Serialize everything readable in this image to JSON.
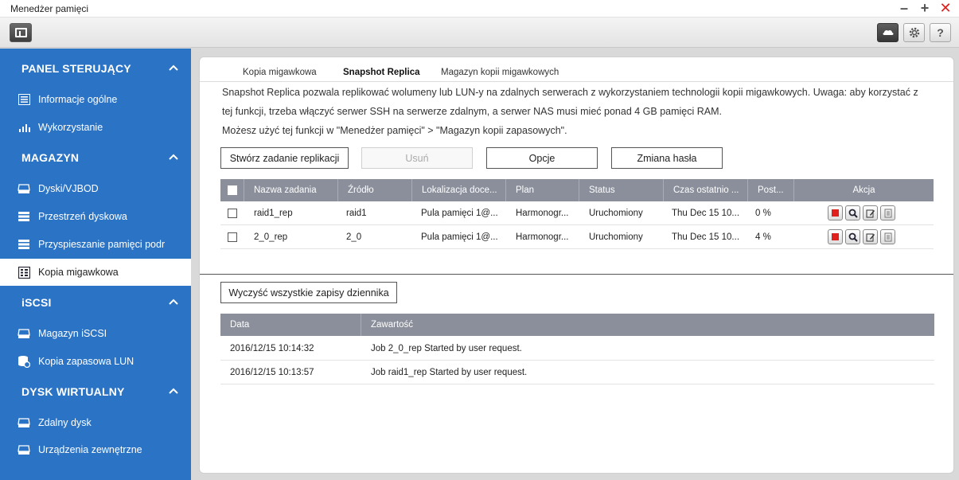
{
  "window": {
    "title": "Menedżer pamięci"
  },
  "sidebar": {
    "sections": [
      {
        "label": "PANEL STERUJĄCY",
        "items": [
          {
            "label": "Informacje ogólne"
          },
          {
            "label": "Wykorzystanie"
          }
        ]
      },
      {
        "label": "MAGAZYN",
        "items": [
          {
            "label": "Dyski/VJBOD"
          },
          {
            "label": "Przestrzeń dyskowa"
          },
          {
            "label": "Przyspieszanie pamięci podr"
          },
          {
            "label": "Kopia migawkowa"
          }
        ]
      },
      {
        "label": "iSCSI",
        "items": [
          {
            "label": "Magazyn iSCSI"
          },
          {
            "label": "Kopia zapasowa LUN"
          }
        ]
      },
      {
        "label": "DYSK WIRTUALNY",
        "items": [
          {
            "label": "Zdalny dysk"
          },
          {
            "label": "Urządzenia zewnętrzne"
          }
        ]
      }
    ]
  },
  "tabs": [
    {
      "label": "Kopia migawkowa"
    },
    {
      "label": "Snapshot Replica"
    },
    {
      "label": "Magazyn kopii migawkowych"
    }
  ],
  "description": {
    "line1": "Snapshot Replica pozwala replikować wolumeny lub LUN-y na zdalnych serwerach z wykorzystaniem technologii kopii migawkowych. Uwaga: aby korzystać z",
    "line2": "tej funkcji, trzeba włączyć serwer SSH na serwerze zdalnym, a serwer NAS musi mieć ponad 4 GB pamięci RAM.",
    "line3": "Możesz użyć tej funkcji w \"Menedżer pamięci\" > \"Magazyn kopii zapasowych\"."
  },
  "actions": {
    "create": "Stwórz zadanie replikacji",
    "delete": "Usuń",
    "options": "Opcje",
    "change_password": "Zmiana hasła"
  },
  "jobs_table": {
    "columns": [
      "Nazwa zadania",
      "Źródło",
      "Lokalizacja doce...",
      "Plan",
      "Status",
      "Czas ostatnio ...",
      "Post...",
      "Akcja"
    ],
    "rows": [
      {
        "name": "raid1_rep",
        "source": "raid1",
        "location": "Pula pamięci 1@...",
        "plan": "Harmonogr...",
        "status": "Uruchomiony",
        "last_time": "Thu Dec 15 10...",
        "progress": "0 %"
      },
      {
        "name": "2_0_rep",
        "source": "2_0",
        "location": "Pula pamięci 1@...",
        "plan": "Harmonogr...",
        "status": "Uruchomiony",
        "last_time": "Thu Dec 15 10...",
        "progress": "4 %"
      }
    ]
  },
  "log": {
    "clear_button": "Wyczyść wszystkie zapisy dziennika",
    "columns": [
      "Data",
      "Zawartość"
    ],
    "rows": [
      {
        "date": "2016/12/15 10:14:32",
        "content": "Job 2_0_rep Started by user request."
      },
      {
        "date": "2016/12/15 10:13:57",
        "content": "Job raid1_rep Started by user request."
      }
    ]
  },
  "colors": {
    "sidebar": "#2b73c5",
    "grid_header": "#8a8f9b",
    "stop": "#e0201c"
  }
}
